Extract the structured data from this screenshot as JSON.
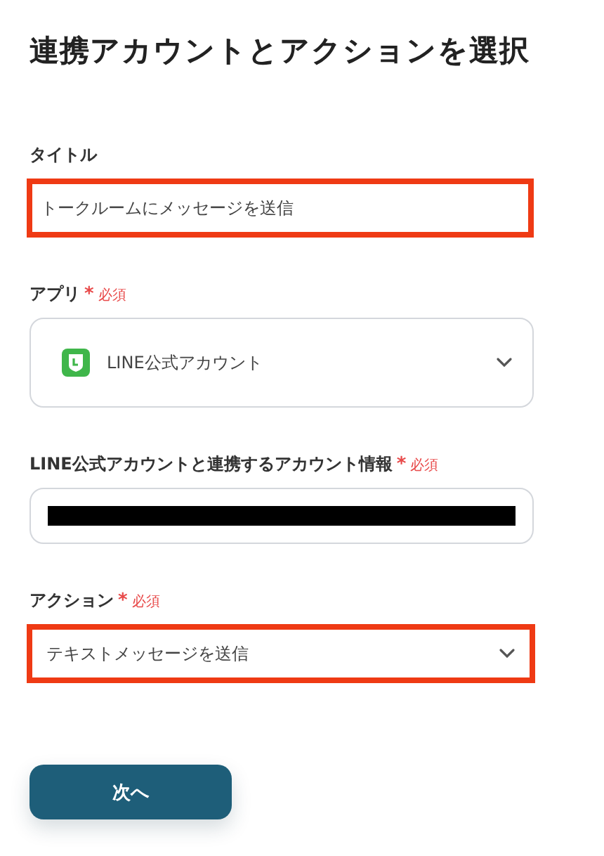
{
  "heading": "連携アカウントとアクションを選択",
  "fields": [
    {
      "kind": "text",
      "label": "タイトル",
      "value": "トークルームにメッセージを送信",
      "highlighted": true
    },
    {
      "kind": "app-select",
      "label": "アプリ",
      "required_mark": "*",
      "required_text": "必須",
      "value": "LINE公式アカウント",
      "highlighted": false
    },
    {
      "kind": "redacted",
      "label": "LINE公式アカウントと連携するアカウント情報",
      "required_mark": "*",
      "required_text": "必須",
      "highlighted": false
    },
    {
      "kind": "select",
      "label": "アクション",
      "required_mark": "*",
      "required_text": "必須",
      "value": "テキストメッセージを送信",
      "highlighted": true
    }
  ],
  "next_button": "次へ"
}
